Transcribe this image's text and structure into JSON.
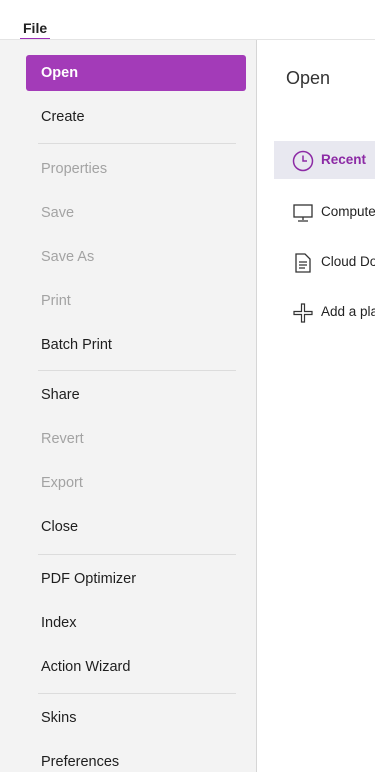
{
  "header": {
    "file_tab": "File"
  },
  "sidebar": {
    "items": [
      {
        "label": "Open",
        "state": "active"
      },
      {
        "label": "Create",
        "state": "enabled"
      },
      {
        "label": "Properties",
        "state": "disabled"
      },
      {
        "label": "Save",
        "state": "disabled"
      },
      {
        "label": "Save As",
        "state": "disabled"
      },
      {
        "label": "Print",
        "state": "disabled"
      },
      {
        "label": "Batch Print",
        "state": "enabled"
      },
      {
        "label": "Share",
        "state": "enabled"
      },
      {
        "label": "Revert",
        "state": "disabled"
      },
      {
        "label": "Export",
        "state": "disabled"
      },
      {
        "label": "Close",
        "state": "enabled"
      },
      {
        "label": "PDF Optimizer",
        "state": "enabled"
      },
      {
        "label": "Index",
        "state": "enabled"
      },
      {
        "label": "Action Wizard",
        "state": "enabled"
      },
      {
        "label": "Skins",
        "state": "enabled"
      },
      {
        "label": "Preferences",
        "state": "enabled"
      }
    ]
  },
  "main": {
    "title": "Open",
    "locations": [
      {
        "label": "Recent",
        "icon": "clock-icon",
        "selected": true
      },
      {
        "label": "Computer",
        "icon": "monitor-icon",
        "selected": false
      },
      {
        "label": "Cloud Documents",
        "icon": "document-icon",
        "selected": false
      },
      {
        "label": "Add a place",
        "icon": "plus-icon",
        "selected": false
      }
    ]
  },
  "colors": {
    "accent": "#a33bb8",
    "accent_text": "#8c2aa5",
    "sidebar_bg": "#f3f3f3"
  }
}
